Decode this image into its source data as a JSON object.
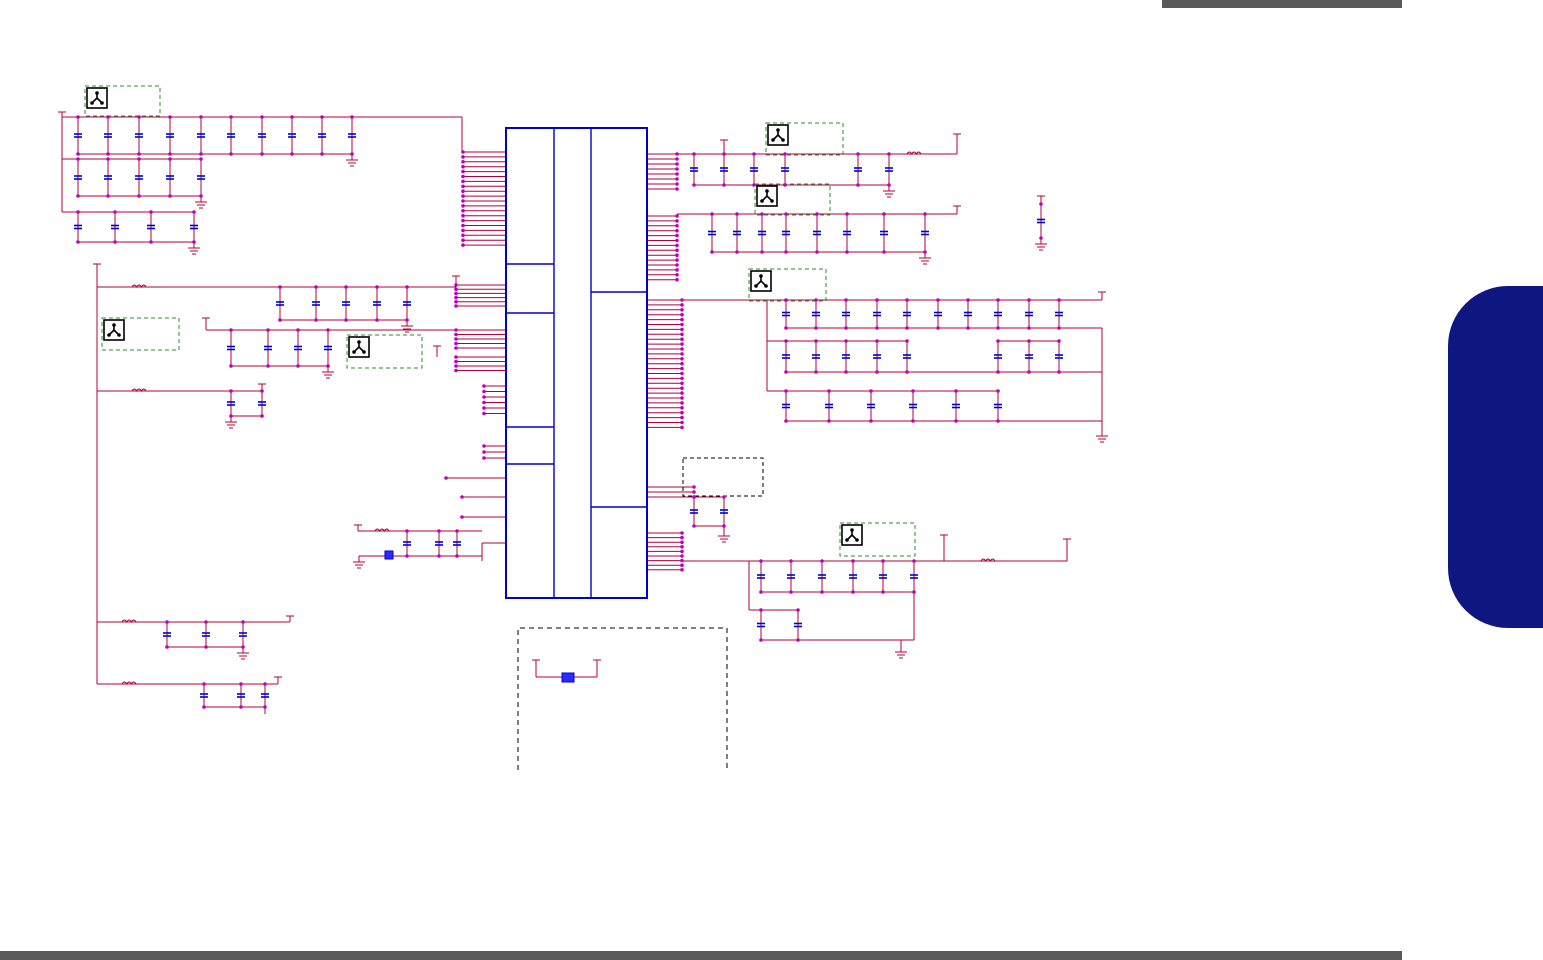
{
  "page": {
    "background": "#ffffff",
    "rule_color": "#595959",
    "tab_color": "#0e1780"
  },
  "schematic": {
    "wire_color": "#b3003b",
    "pin_color": "#c000c0",
    "chip_color": "#0000cc",
    "capacitor_color": "#0000cc",
    "note_frame_color": "#2e8b2e",
    "icons": [
      "pcb-layout-note-icon"
    ]
  }
}
